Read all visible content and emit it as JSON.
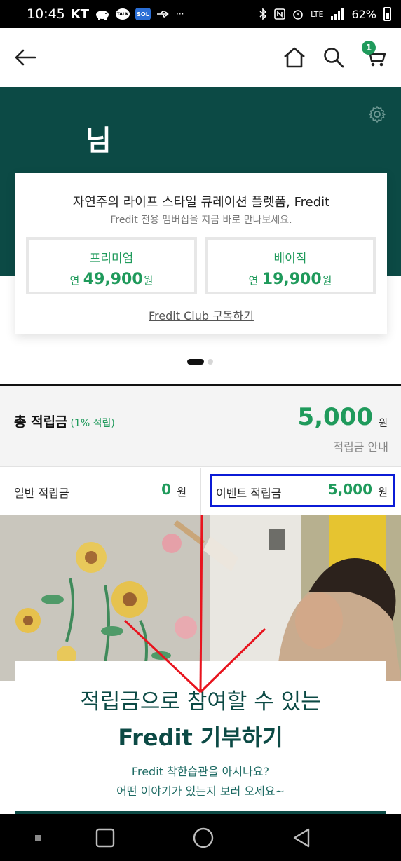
{
  "status_bar": {
    "time": "10:45",
    "carrier": "KT",
    "talk_badge": "TALK",
    "sol_badge": "SOL",
    "more": "···",
    "network": "LTE",
    "battery": "62%"
  },
  "header": {
    "back_icon": "arrow-left-icon",
    "home_icon": "home-icon",
    "search_icon": "search-icon",
    "cart_icon": "cart-icon",
    "cart_count": "1"
  },
  "hero": {
    "user_name": "님",
    "settings_icon": "gear-icon"
  },
  "membership": {
    "title": "자연주의 라이프 스타일 큐레이션 플렛폼, Fredit",
    "subtitle": "Fredit 전용 멤버십을 지금 바로 만나보세요.",
    "plans": [
      {
        "name": "프리미엄",
        "prefix": "연",
        "amount": "49,900",
        "unit": "원"
      },
      {
        "name": "베이직",
        "prefix": "연",
        "amount": "19,900",
        "unit": "원"
      }
    ],
    "subscribe_label": "Fredit Club 구독하기"
  },
  "pager": {
    "total": 2,
    "active": 1
  },
  "points": {
    "label": "총 적립금",
    "rate": "(1% 적립)",
    "total": "5,000",
    "unit": "원",
    "guide_link": "적립금 안내",
    "general": {
      "label": "일반 적립금",
      "amount": "0",
      "unit": "원"
    },
    "event": {
      "label": "이벤트 적립금",
      "amount": "5,000",
      "unit": "원"
    }
  },
  "banner": {
    "line1": "적립금으로 참여할 수 있는",
    "line2": "Fredit 기부하기",
    "sub1": "Fredit 착한습관을 아시나요?",
    "sub2": "어떤 이야기가 있는지 보러 오세요~"
  },
  "colors": {
    "brand_green": "#0c4a45",
    "accent_green": "#1f9a5b",
    "annotation_blue": "#0b1bd6",
    "annotation_red": "#e8141e"
  },
  "nav_bar": {
    "recents_icon": "recents-icon",
    "home_icon": "nav-home-icon",
    "back_icon": "nav-back-icon"
  }
}
